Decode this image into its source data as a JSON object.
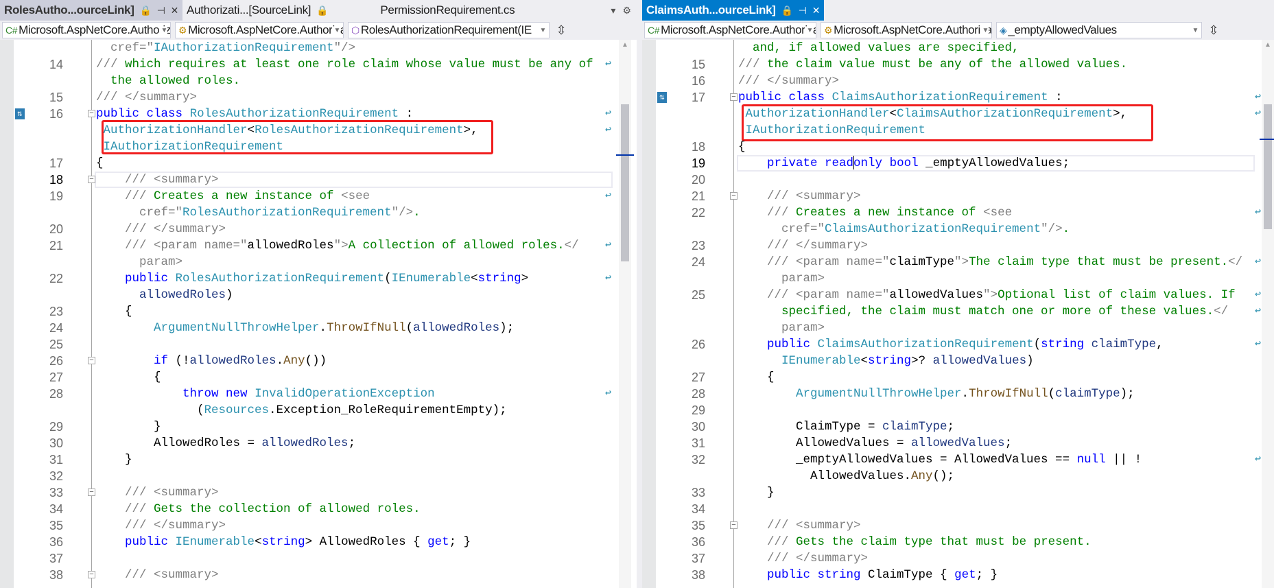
{
  "left": {
    "tabs": [
      {
        "label": "RolesAutho...ourceLink]",
        "state": "selected-inactive",
        "icons": [
          "lock-icon",
          "pin-icon",
          "close-icon"
        ]
      },
      {
        "label": "Authorizati...[SourceLink]",
        "state": "normal",
        "icons": [
          "lock-icon"
        ]
      },
      {
        "label": "PermissionRequirement.cs",
        "state": "normal",
        "icons": []
      }
    ],
    "nav": [
      "Microsoft.AspNetCore.Authorizati",
      "Microsoft.AspNetCore.Authorizati",
      "RolesAuthorizationRequirement(IE"
    ],
    "rows": [
      {
        "n": "",
        "i": 2,
        "s": [
          [
            "g",
            "cref=\""
          ],
          [
            "t",
            "IAuthorizationRequirement"
          ],
          [
            "g",
            "\"/>"
          ]
        ]
      },
      {
        "n": "14",
        "i": 0,
        "w": 1,
        "s": [
          [
            "g",
            "///"
          ],
          [
            "c",
            " which requires at least one role claim whose value must be any of"
          ]
        ]
      },
      {
        "n": "",
        "i": 2,
        "s": [
          [
            "c",
            "the allowed roles."
          ]
        ]
      },
      {
        "n": "15",
        "i": 0,
        "s": [
          [
            "g",
            "/// </summary>"
          ]
        ]
      },
      {
        "n": "16",
        "i": 0,
        "w": 1,
        "o": 1,
        "gi": 1,
        "s": [
          [
            "k",
            "public"
          ],
          [
            "n",
            " "
          ],
          [
            "k",
            "class"
          ],
          [
            "n",
            " "
          ],
          [
            "t",
            "RolesAuthorizationRequirement"
          ],
          [
            "n",
            " :"
          ]
        ]
      },
      {
        "n": "",
        "i": 1,
        "w": 1,
        "s": [
          [
            "t",
            "AuthorizationHandler"
          ],
          [
            "n",
            "<"
          ],
          [
            "t",
            "RolesAuthorizationRequirement"
          ],
          [
            "n",
            ">,"
          ]
        ]
      },
      {
        "n": "",
        "i": 1,
        "s": [
          [
            "t",
            "IAuthorizationRequirement"
          ]
        ]
      },
      {
        "n": "17",
        "i": 0,
        "s": [
          [
            "n",
            "{"
          ]
        ]
      },
      {
        "n": "18",
        "i": 4,
        "o": 1,
        "cur": 1,
        "s": [
          [
            "g",
            "/// <summary>"
          ]
        ]
      },
      {
        "n": "19",
        "i": 4,
        "w": 1,
        "s": [
          [
            "g",
            "///"
          ],
          [
            "c",
            " Creates a new instance of "
          ],
          [
            "g",
            "<see"
          ]
        ]
      },
      {
        "n": "",
        "i": 6,
        "s": [
          [
            "g",
            "cref=\""
          ],
          [
            "t",
            "RolesAuthorizationRequirement"
          ],
          [
            "g",
            "\"/>"
          ],
          [
            "c",
            "."
          ]
        ]
      },
      {
        "n": "20",
        "i": 4,
        "s": [
          [
            "g",
            "/// </summary>"
          ]
        ]
      },
      {
        "n": "21",
        "i": 4,
        "w": 1,
        "s": [
          [
            "g",
            "/// <param name=\""
          ],
          [
            "n",
            "allowedRoles"
          ],
          [
            "g",
            "\">"
          ],
          [
            "c",
            "A collection of allowed roles."
          ],
          [
            "g",
            "</"
          ]
        ]
      },
      {
        "n": "",
        "i": 6,
        "s": [
          [
            "g",
            "param>"
          ]
        ]
      },
      {
        "n": "22",
        "i": 4,
        "w": 1,
        "s": [
          [
            "k",
            "public"
          ],
          [
            "n",
            " "
          ],
          [
            "t",
            "RolesAuthorizationRequirement"
          ],
          [
            "n",
            "("
          ],
          [
            "t",
            "IEnumerable"
          ],
          [
            "n",
            "<"
          ],
          [
            "k",
            "string"
          ],
          [
            "n",
            ">"
          ]
        ]
      },
      {
        "n": "",
        "i": 6,
        "s": [
          [
            "p",
            "allowedRoles"
          ],
          [
            "n",
            ")"
          ]
        ]
      },
      {
        "n": "23",
        "i": 4,
        "s": [
          [
            "n",
            "{"
          ]
        ]
      },
      {
        "n": "24",
        "i": 8,
        "s": [
          [
            "t",
            "ArgumentNullThrowHelper"
          ],
          [
            "n",
            "."
          ],
          [
            "m",
            "ThrowIfNull"
          ],
          [
            "n",
            "("
          ],
          [
            "p",
            "allowedRoles"
          ],
          [
            "n",
            ");"
          ]
        ]
      },
      {
        "n": "25",
        "i": 0,
        "s": []
      },
      {
        "n": "26",
        "i": 8,
        "o": 1,
        "s": [
          [
            "k",
            "if"
          ],
          [
            "n",
            " (!"
          ],
          [
            "p",
            "allowedRoles"
          ],
          [
            "n",
            "."
          ],
          [
            "m",
            "Any"
          ],
          [
            "n",
            "())"
          ]
        ]
      },
      {
        "n": "27",
        "i": 8,
        "s": [
          [
            "n",
            "{"
          ]
        ]
      },
      {
        "n": "28",
        "i": 12,
        "w": 1,
        "s": [
          [
            "k",
            "throw"
          ],
          [
            "n",
            " "
          ],
          [
            "k",
            "new"
          ],
          [
            "n",
            " "
          ],
          [
            "t",
            "InvalidOperationException"
          ]
        ]
      },
      {
        "n": "",
        "i": 14,
        "s": [
          [
            "n",
            "("
          ],
          [
            "t",
            "Resources"
          ],
          [
            "n",
            ".Exception_RoleRequirementEmpty);"
          ]
        ]
      },
      {
        "n": "29",
        "i": 8,
        "s": [
          [
            "n",
            "}"
          ]
        ]
      },
      {
        "n": "30",
        "i": 8,
        "s": [
          [
            "n",
            "AllowedRoles = "
          ],
          [
            "p",
            "allowedRoles"
          ],
          [
            "n",
            ";"
          ]
        ]
      },
      {
        "n": "31",
        "i": 4,
        "s": [
          [
            "n",
            "}"
          ]
        ]
      },
      {
        "n": "32",
        "i": 0,
        "s": []
      },
      {
        "n": "33",
        "i": 4,
        "o": 1,
        "s": [
          [
            "g",
            "/// <summary>"
          ]
        ]
      },
      {
        "n": "34",
        "i": 4,
        "s": [
          [
            "g",
            "///"
          ],
          [
            "c",
            " Gets the collection of allowed roles."
          ]
        ]
      },
      {
        "n": "35",
        "i": 4,
        "s": [
          [
            "g",
            "/// </summary>"
          ]
        ]
      },
      {
        "n": "36",
        "i": 4,
        "s": [
          [
            "k",
            "public"
          ],
          [
            "n",
            " "
          ],
          [
            "t",
            "IEnumerable"
          ],
          [
            "n",
            "<"
          ],
          [
            "k",
            "string"
          ],
          [
            "n",
            "> AllowedRoles { "
          ],
          [
            "k",
            "get"
          ],
          [
            "n",
            "; }"
          ]
        ]
      },
      {
        "n": "37",
        "i": 0,
        "s": []
      },
      {
        "n": "38",
        "i": 4,
        "o": 1,
        "s": [
          [
            "g",
            "/// <summary>"
          ]
        ]
      }
    ]
  },
  "right": {
    "tabs": [
      {
        "label": "ClaimsAuth...ourceLink]",
        "state": "active",
        "icons": [
          "lock-icon",
          "pin-icon",
          "close-icon"
        ]
      }
    ],
    "nav": [
      "Microsoft.AspNetCore.Authorizatic",
      "Microsoft.AspNetCore.Authorizatic",
      "_emptyAllowedValues"
    ],
    "rows": [
      {
        "n": "",
        "i": 2,
        "s": [
          [
            "c",
            "and, if allowed values are specified,"
          ]
        ]
      },
      {
        "n": "15",
        "i": 0,
        "s": [
          [
            "g",
            "///"
          ],
          [
            "c",
            " the claim value must be any of the allowed values."
          ]
        ]
      },
      {
        "n": "16",
        "i": 0,
        "s": [
          [
            "g",
            "/// </summary>"
          ]
        ]
      },
      {
        "n": "17",
        "i": 0,
        "w": 1,
        "o": 1,
        "gi": 1,
        "s": [
          [
            "k",
            "public"
          ],
          [
            "n",
            " "
          ],
          [
            "k",
            "class"
          ],
          [
            "n",
            " "
          ],
          [
            "t",
            "ClaimsAuthorizationRequirement"
          ],
          [
            "n",
            " :"
          ]
        ]
      },
      {
        "n": "",
        "i": 1,
        "w": 1,
        "s": [
          [
            "t",
            "AuthorizationHandler"
          ],
          [
            "n",
            "<"
          ],
          [
            "t",
            "ClaimsAuthorizationRequirement"
          ],
          [
            "n",
            ">,"
          ]
        ]
      },
      {
        "n": "",
        "i": 1,
        "s": [
          [
            "t",
            "IAuthorizationRequirement"
          ]
        ]
      },
      {
        "n": "18",
        "i": 0,
        "s": [
          [
            "n",
            "{"
          ]
        ]
      },
      {
        "n": "19",
        "i": 4,
        "cur": 1,
        "s": [
          [
            "k",
            "private"
          ],
          [
            "n",
            " "
          ],
          [
            "k",
            "read"
          ],
          [
            "caret",
            ""
          ],
          [
            "k",
            "only"
          ],
          [
            "n",
            " "
          ],
          [
            "k",
            "bool"
          ],
          [
            "n",
            " _emptyAllowedValues;"
          ]
        ]
      },
      {
        "n": "20",
        "i": 0,
        "s": []
      },
      {
        "n": "21",
        "i": 4,
        "o": 1,
        "s": [
          [
            "g",
            "/// <summary>"
          ]
        ]
      },
      {
        "n": "22",
        "i": 4,
        "w": 1,
        "s": [
          [
            "g",
            "///"
          ],
          [
            "c",
            " Creates a new instance of "
          ],
          [
            "g",
            "<see"
          ]
        ]
      },
      {
        "n": "",
        "i": 6,
        "s": [
          [
            "g",
            "cref=\""
          ],
          [
            "t",
            "ClaimsAuthorizationRequirement"
          ],
          [
            "g",
            "\"/>"
          ],
          [
            "c",
            "."
          ]
        ]
      },
      {
        "n": "23",
        "i": 4,
        "s": [
          [
            "g",
            "/// </summary>"
          ]
        ]
      },
      {
        "n": "24",
        "i": 4,
        "w": 1,
        "s": [
          [
            "g",
            "/// <param name=\""
          ],
          [
            "n",
            "claimType"
          ],
          [
            "g",
            "\">"
          ],
          [
            "c",
            "The claim type that must be present."
          ],
          [
            "g",
            "</"
          ]
        ]
      },
      {
        "n": "",
        "i": 6,
        "s": [
          [
            "g",
            "param>"
          ]
        ]
      },
      {
        "n": "25",
        "i": 4,
        "w": 1,
        "s": [
          [
            "g",
            "/// <param name=\""
          ],
          [
            "n",
            "allowedValues"
          ],
          [
            "g",
            "\">"
          ],
          [
            "c",
            "Optional list of claim values. If"
          ]
        ]
      },
      {
        "n": "",
        "i": 6,
        "w": 1,
        "s": [
          [
            "c",
            "specified, the claim must match one or more of these values."
          ],
          [
            "g",
            "</"
          ]
        ]
      },
      {
        "n": "",
        "i": 6,
        "s": [
          [
            "g",
            "param>"
          ]
        ]
      },
      {
        "n": "26",
        "i": 4,
        "w": 1,
        "s": [
          [
            "k",
            "public"
          ],
          [
            "n",
            " "
          ],
          [
            "t",
            "ClaimsAuthorizationRequirement"
          ],
          [
            "n",
            "("
          ],
          [
            "k",
            "string"
          ],
          [
            "n",
            " "
          ],
          [
            "p",
            "claimType"
          ],
          [
            "n",
            ","
          ]
        ]
      },
      {
        "n": "",
        "i": 6,
        "s": [
          [
            "t",
            "IEnumerable"
          ],
          [
            "n",
            "<"
          ],
          [
            "k",
            "string"
          ],
          [
            "n",
            ">? "
          ],
          [
            "p",
            "allowedValues"
          ],
          [
            "n",
            ")"
          ]
        ]
      },
      {
        "n": "27",
        "i": 4,
        "s": [
          [
            "n",
            "{"
          ]
        ]
      },
      {
        "n": "28",
        "i": 8,
        "s": [
          [
            "t",
            "ArgumentNullThrowHelper"
          ],
          [
            "n",
            "."
          ],
          [
            "m",
            "ThrowIfNull"
          ],
          [
            "n",
            "("
          ],
          [
            "p",
            "claimType"
          ],
          [
            "n",
            ");"
          ]
        ]
      },
      {
        "n": "29",
        "i": 0,
        "s": []
      },
      {
        "n": "30",
        "i": 8,
        "s": [
          [
            "n",
            "ClaimType = "
          ],
          [
            "p",
            "claimType"
          ],
          [
            "n",
            ";"
          ]
        ]
      },
      {
        "n": "31",
        "i": 8,
        "s": [
          [
            "n",
            "AllowedValues = "
          ],
          [
            "p",
            "allowedValues"
          ],
          [
            "n",
            ";"
          ]
        ]
      },
      {
        "n": "32",
        "i": 8,
        "w": 1,
        "s": [
          [
            "n",
            "_emptyAllowedValues = AllowedValues == "
          ],
          [
            "k",
            "null"
          ],
          [
            "n",
            " || !"
          ]
        ]
      },
      {
        "n": "",
        "i": 10,
        "s": [
          [
            "n",
            "AllowedValues."
          ],
          [
            "m",
            "Any"
          ],
          [
            "n",
            "();"
          ]
        ]
      },
      {
        "n": "33",
        "i": 4,
        "s": [
          [
            "n",
            "}"
          ]
        ]
      },
      {
        "n": "34",
        "i": 0,
        "s": []
      },
      {
        "n": "35",
        "i": 4,
        "o": 1,
        "s": [
          [
            "g",
            "/// <summary>"
          ]
        ]
      },
      {
        "n": "36",
        "i": 4,
        "s": [
          [
            "g",
            "///"
          ],
          [
            "c",
            " Gets the claim type that must be present."
          ]
        ]
      },
      {
        "n": "37",
        "i": 4,
        "s": [
          [
            "g",
            "/// </summary>"
          ]
        ]
      },
      {
        "n": "38",
        "i": 4,
        "s": [
          [
            "k",
            "public"
          ],
          [
            "n",
            " "
          ],
          [
            "k",
            "string"
          ],
          [
            "n",
            " ClaimType { "
          ],
          [
            "k",
            "get"
          ],
          [
            "n",
            "; }"
          ]
        ]
      }
    ]
  },
  "colors": {
    "accent": "#007ACC",
    "highlight_box": "#F01E1E",
    "keyword": "#0000FF",
    "type": "#2B91AF",
    "comment": "#008000"
  },
  "icons": {
    "lock": "🔒",
    "pin": "⊣",
    "close": "✕",
    "wrap": "↩",
    "dropdown": "▾",
    "settings": "⚙"
  }
}
